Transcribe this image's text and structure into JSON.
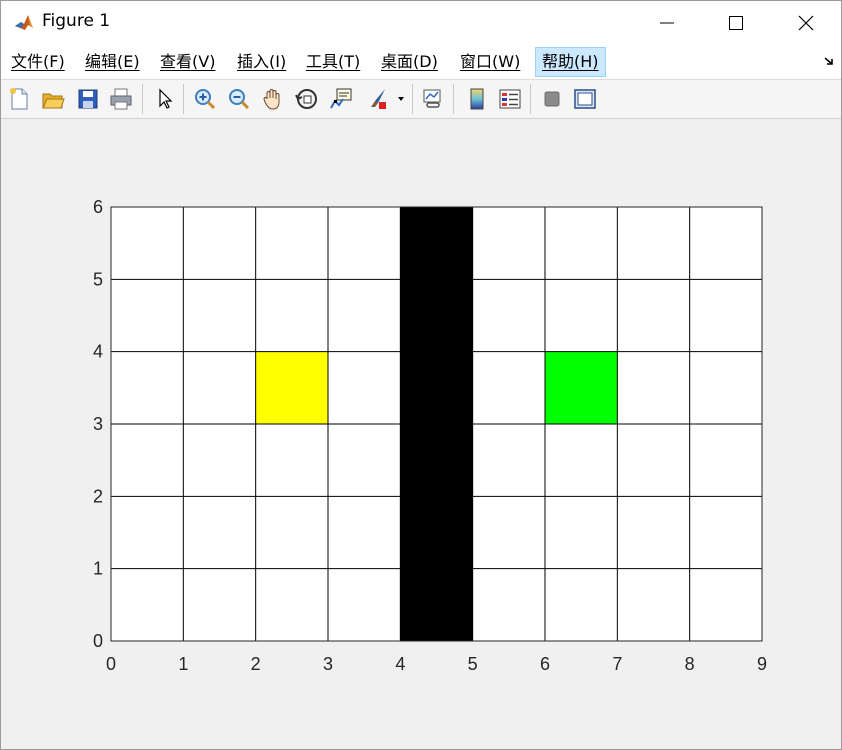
{
  "window": {
    "title": "Figure 1",
    "controls": [
      "minimize",
      "maximize",
      "close"
    ]
  },
  "menu": {
    "items": [
      {
        "label": "文件(F)"
      },
      {
        "label": "编辑(E)"
      },
      {
        "label": "查看(V)"
      },
      {
        "label": "插入(I)"
      },
      {
        "label": "工具(T)"
      },
      {
        "label": "桌面(D)"
      },
      {
        "label": "窗口(W)"
      },
      {
        "label": "帮助(H)"
      }
    ],
    "active_index": 7
  },
  "toolbar": {
    "icons": [
      "new-figure-icon",
      "open-file-icon",
      "save-icon",
      "print-icon",
      "edit-plot-icon",
      "zoom-in-icon",
      "zoom-out-icon",
      "pan-icon",
      "rotate-3d-icon",
      "data-cursor-icon",
      "brush-icon",
      "link-plot-icon",
      "insert-colorbar-icon",
      "insert-legend-icon",
      "hide-plot-tools-icon",
      "show-plot-tools-icon"
    ]
  },
  "chart_data": {
    "type": "heatmap",
    "title": "",
    "xlabel": "",
    "ylabel": "",
    "xlim": [
      0,
      9
    ],
    "ylim": [
      0,
      6
    ],
    "xticks": [
      "0",
      "1",
      "2",
      "3",
      "4",
      "5",
      "6",
      "7",
      "8",
      "9"
    ],
    "yticks": [
      "0",
      "1",
      "2",
      "3",
      "4",
      "5",
      "6"
    ],
    "grid": true,
    "background_color": "#ffffff",
    "cells": [
      {
        "x": 2,
        "y": 3,
        "color": "#ffff00"
      },
      {
        "x": 6,
        "y": 3,
        "color": "#00ff00"
      },
      {
        "x": 4,
        "y": 0,
        "color": "#000000"
      },
      {
        "x": 4,
        "y": 1,
        "color": "#000000"
      },
      {
        "x": 4,
        "y": 2,
        "color": "#000000"
      },
      {
        "x": 4,
        "y": 3,
        "color": "#000000"
      },
      {
        "x": 4,
        "y": 4,
        "color": "#000000"
      },
      {
        "x": 4,
        "y": 5,
        "color": "#000000"
      }
    ]
  }
}
